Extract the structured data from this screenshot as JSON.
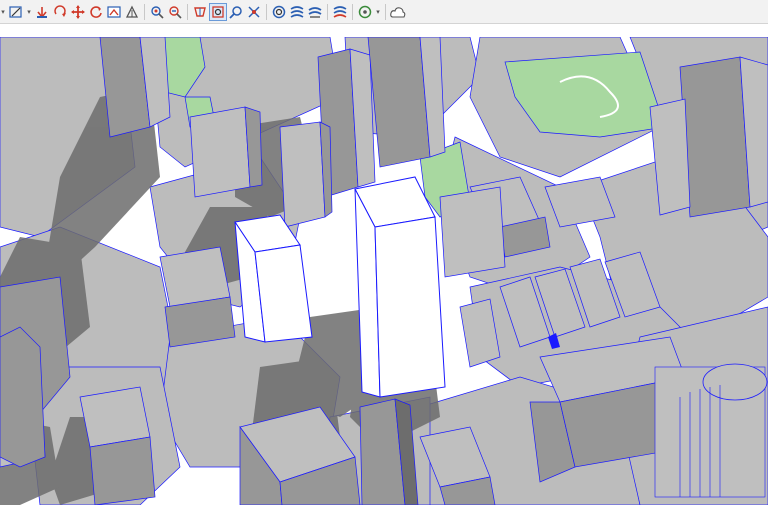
{
  "toolbar": {
    "tools": [
      {
        "name": "shading-dropdown-icon"
      },
      {
        "name": "edit-box-icon"
      },
      {
        "name": "pan-down-icon"
      },
      {
        "name": "orbit-icon"
      },
      {
        "name": "move-cross-icon"
      },
      {
        "name": "rotate-icon"
      },
      {
        "name": "map-zoom-icon"
      },
      {
        "name": "shadow-study-icon"
      },
      {
        "name": "locate-pin-icon"
      },
      {
        "name": "measure-icon"
      },
      {
        "name": "perspective-icon"
      },
      {
        "name": "select-arrow-icon"
      },
      {
        "name": "search-zoom-icon"
      },
      {
        "name": "extents-icon"
      },
      {
        "name": "layers-icon"
      },
      {
        "name": "style-a-icon"
      },
      {
        "name": "style-b-icon"
      },
      {
        "name": "style-c-icon"
      },
      {
        "name": "globe-icon"
      },
      {
        "name": "cloud-icon"
      }
    ],
    "active_tool": "perspective-icon"
  },
  "colors": {
    "toolbar_bg": "#f2f2f2",
    "road": "#ffffff",
    "block": "#bcbcbc",
    "building_top": "#bfbfbf",
    "building_side": "#979797",
    "shadow": "#6d6d6d",
    "park": "#a8d8a0",
    "selection": "#1a1aff",
    "selected_fill": "#ffffff"
  },
  "viewport": {
    "name": "3d-city-scene",
    "selected_buildings": 2
  }
}
